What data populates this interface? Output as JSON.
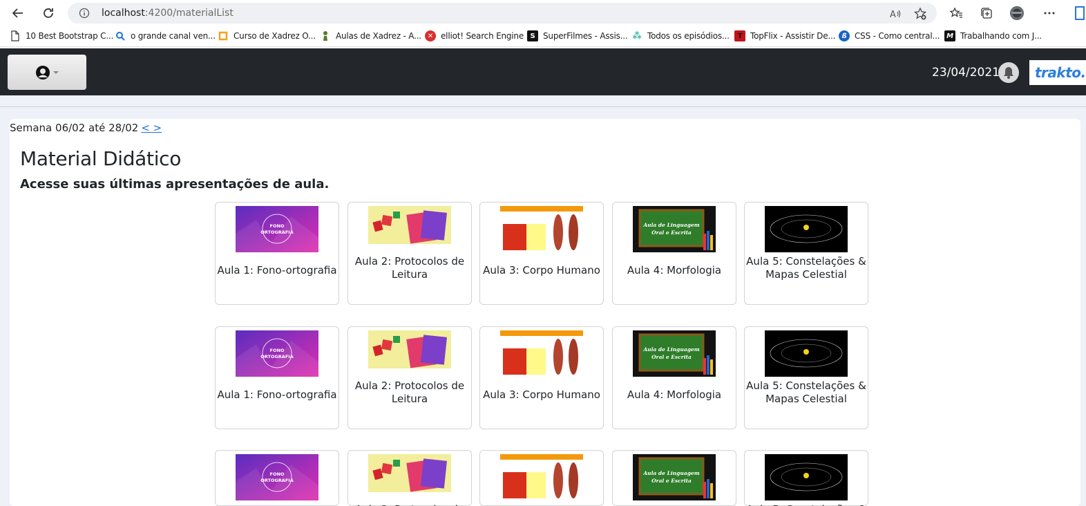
{
  "browser": {
    "url_host": "localhost",
    "url_path": ":4200/materialList",
    "bookmarks": [
      {
        "label": "10 Best Bootstrap C...",
        "icon": "page-icon"
      },
      {
        "label": "o grande canal ven...",
        "icon": "search-icon"
      },
      {
        "label": "Curso de Xadrez O...",
        "icon": "bracket-icon"
      },
      {
        "label": "Aulas de Xadrez - A...",
        "icon": "chess-pawn-icon"
      },
      {
        "label": "elliot! Search Engine",
        "icon": "elliot-icon"
      },
      {
        "label": "SuperFilmes - Assis...",
        "icon": "s-icon"
      },
      {
        "label": "Todos os episódios...",
        "icon": "sparkle-icon"
      },
      {
        "label": "TopFlix - Assistir De...",
        "icon": "t-icon"
      },
      {
        "label": "CSS - Como central...",
        "icon": "b-icon"
      },
      {
        "label": "Trabalhando com J...",
        "icon": "m-icon"
      }
    ]
  },
  "header": {
    "date": "23/04/2021",
    "logo": "trakto."
  },
  "page": {
    "week_label": "Semana 06/02 até 28/02",
    "week_nav": "< >",
    "title": "Material Didático",
    "subtitle": "Acesse suas últimas apresentações de aula."
  },
  "lessons": [
    {
      "title": "Aula 1: Fono-ortografia",
      "thumb": "fono",
      "thumb_text": "FONO ORTOGRAFIA"
    },
    {
      "title": "Aula 2: Protocolos de Leitura",
      "thumb": "protocolos"
    },
    {
      "title": "Aula 3: Corpo Humano",
      "thumb": "corpo"
    },
    {
      "title": "Aula 4: Morfologia",
      "thumb": "morfologia",
      "thumb_text": "Aula de Linguagem Oral e Escrita"
    },
    {
      "title": "Aula 5: Constelações & Mapas Celestial",
      "thumb": "constelacoes"
    }
  ],
  "colors": {
    "header_bg": "#23272b",
    "page_bg": "#eef1f8",
    "link": "#1a73d9",
    "logo": "#2d7fd9"
  }
}
